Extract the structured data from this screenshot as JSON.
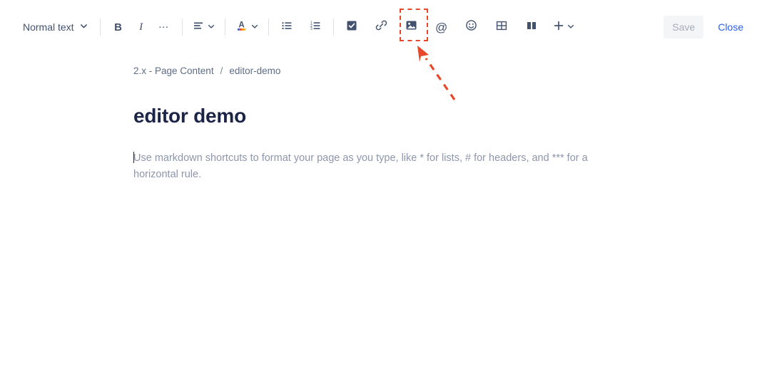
{
  "toolbar": {
    "style_select": {
      "label": "Normal text",
      "icon": "chevron-down-icon"
    },
    "bold": {
      "label": "B",
      "name": "bold-button"
    },
    "italic": {
      "label": "I",
      "name": "italic-button"
    },
    "more_formatting": {
      "label": "…",
      "name": "more-formatting-button"
    },
    "align": {
      "name": "text-align-icon"
    },
    "text_color": {
      "label": "A",
      "name": "text-color-icon"
    },
    "bullet_list": {
      "name": "bullet-list-icon"
    },
    "numbered_list": {
      "name": "numbered-list-icon"
    },
    "task_list": {
      "name": "checkbox-icon"
    },
    "link": {
      "name": "link-icon"
    },
    "image": {
      "name": "image-icon"
    },
    "mention": {
      "label": "@",
      "name": "mention-icon"
    },
    "emoji": {
      "name": "emoji-icon"
    },
    "table": {
      "name": "table-icon"
    },
    "layout": {
      "name": "layout-columns-icon"
    },
    "insert_more": {
      "label": "+",
      "name": "insert-more-icon"
    },
    "save_label": "Save",
    "close_label": "Close"
  },
  "breadcrumb": {
    "items": [
      "2.x - Page Content",
      "editor-demo"
    ],
    "separator": "/"
  },
  "page": {
    "title": "editor demo",
    "placeholder": "Use markdown shortcuts to format your page as you type, like * for lists, # for headers, and *** for a horizontal rule."
  },
  "annotation": {
    "color": "#e8472a",
    "target": "image-icon",
    "style": "dashed-box-with-arrow"
  },
  "colors": {
    "accent_link": "#2a60f2",
    "icon": "#42526e",
    "title": "#1d2547",
    "placeholder": "#8d96ab",
    "breadcrumb": "#5e6c84",
    "save_bg": "#f4f5f7",
    "save_text": "#a5adba",
    "annotation": "#e8472a"
  }
}
